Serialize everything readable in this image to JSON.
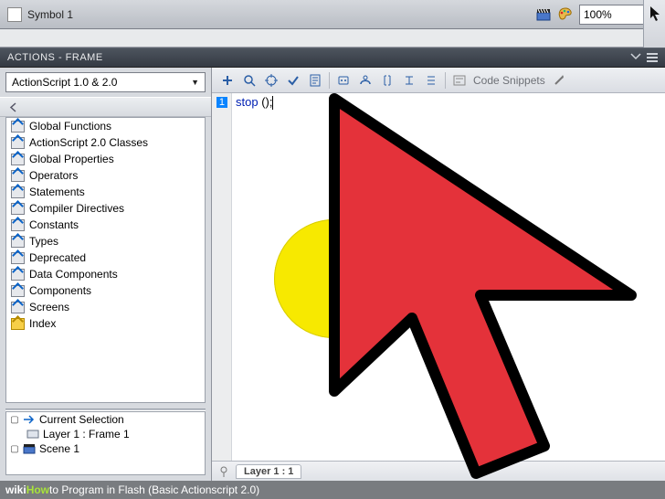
{
  "topbar": {
    "doc_title": "Symbol 1",
    "zoom": "100%"
  },
  "panel": {
    "title": "ACTIONS - FRAME"
  },
  "as_selector": {
    "label": "ActionScript 1.0 & 2.0"
  },
  "tree_items": [
    "Global Functions",
    "ActionScript 2.0 Classes",
    "Global Properties",
    "Operators",
    "Statements",
    "Compiler Directives",
    "Constants",
    "Types",
    "Deprecated",
    "Data Components",
    "Components",
    "Screens",
    "Index"
  ],
  "selection": {
    "header": "Current Selection",
    "layer": "Layer 1 : Frame 1",
    "scene": "Scene 1"
  },
  "editor": {
    "code_snippets_label": "Code Snippets",
    "line_number": "1",
    "code_keyword": "stop",
    "code_rest": " ();",
    "status_tab": "Layer 1 : 1"
  },
  "caption": {
    "wiki": "wiki",
    "how": "How",
    "rest": " to Program in Flash (Basic Actionscript 2.0)"
  }
}
